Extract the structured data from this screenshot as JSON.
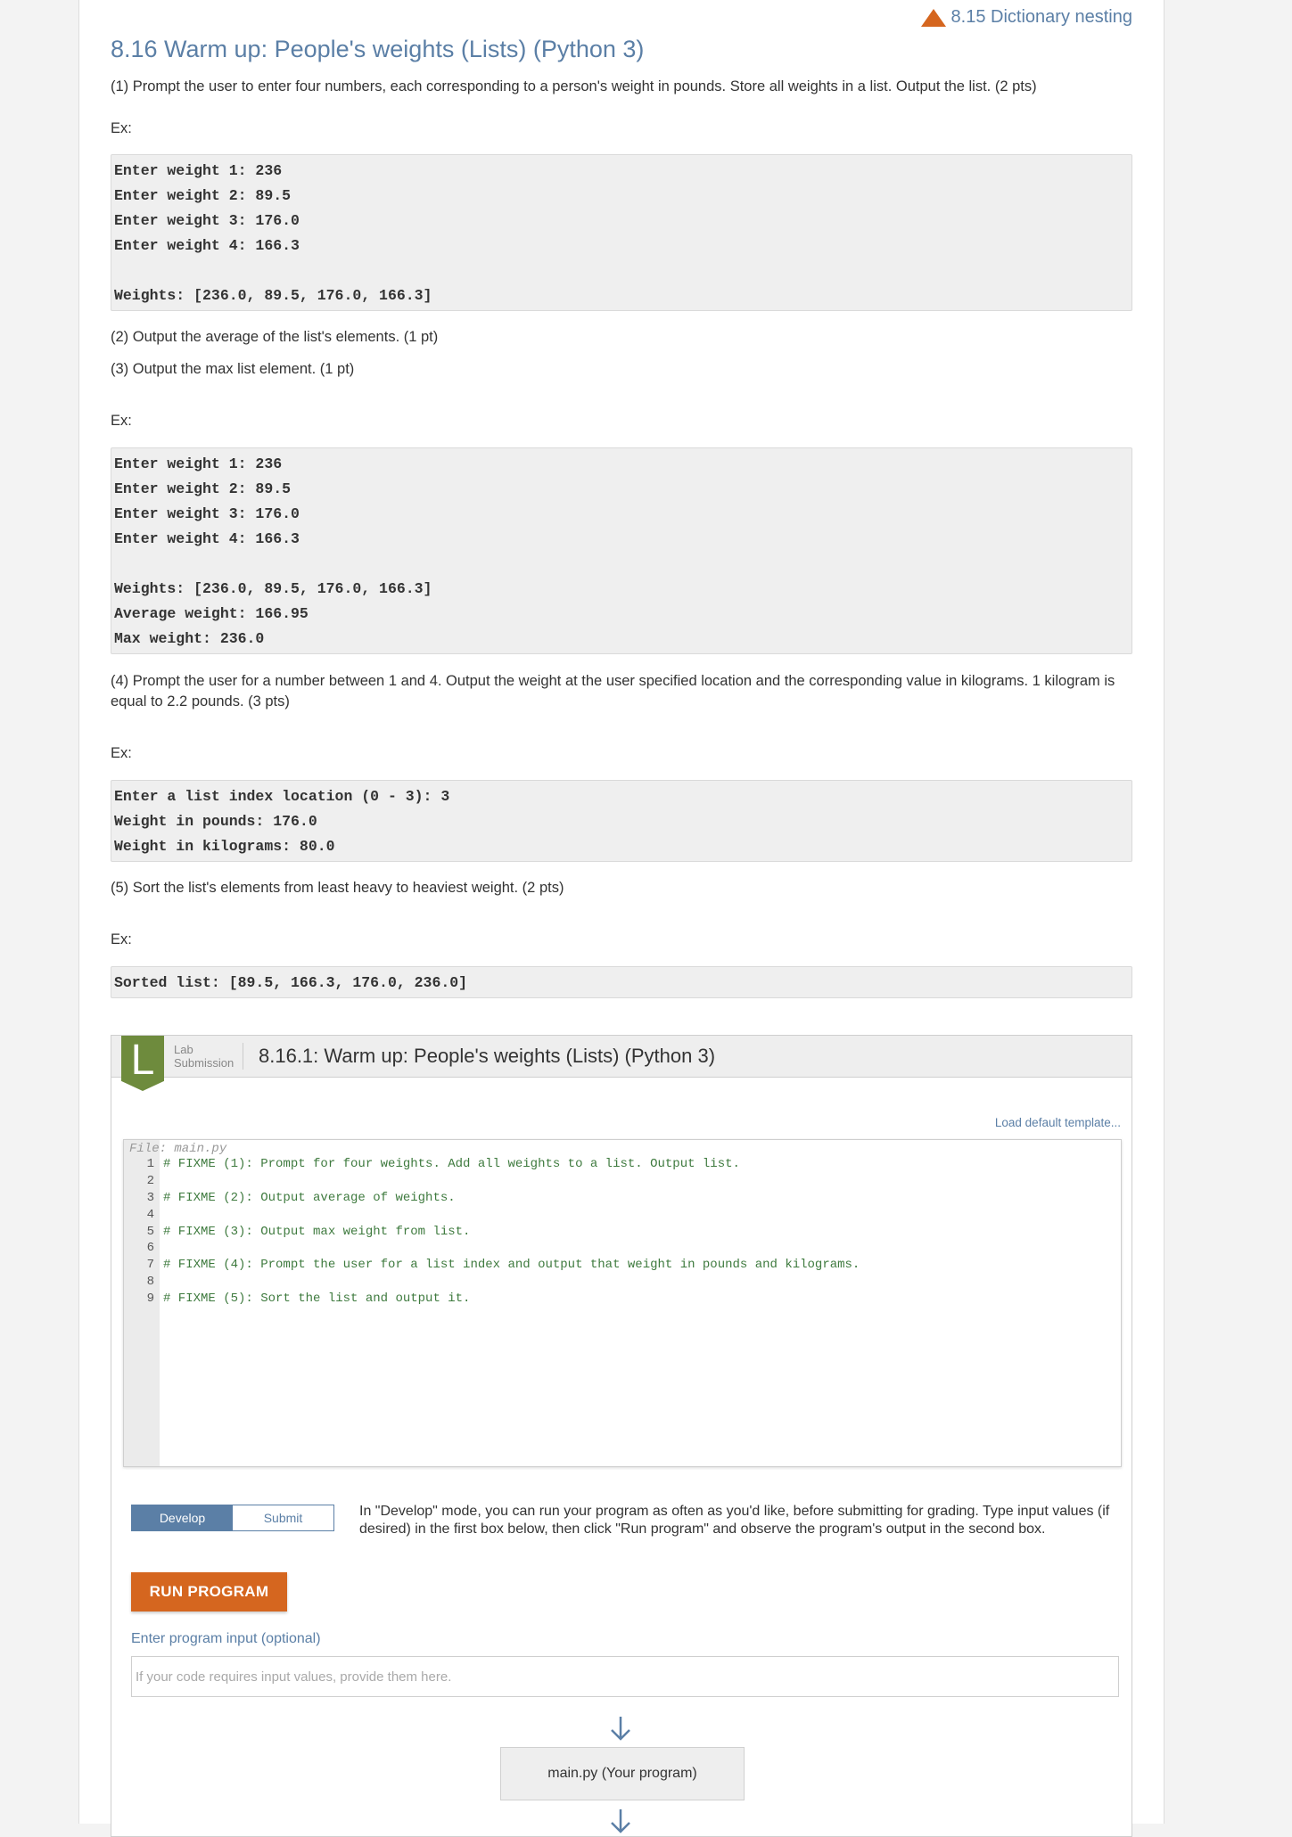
{
  "nav": {
    "prev_link": "8.15 Dictionary nesting"
  },
  "section": {
    "title": "8.16 Warm up: People's weights (Lists) (Python 3)",
    "p1": "(1) Prompt the user to enter four numbers, each corresponding to a person's weight in pounds. Store all weights in a list. Output the list. (2 pts)",
    "ex_label": "Ex:",
    "ex1_lines": [
      "Enter weight 1: 236",
      "Enter weight 2: 89.5",
      "Enter weight 3: 176.0",
      "Enter weight 4: 166.3",
      "",
      "Weights: [236.0, 89.5, 176.0, 166.3]"
    ],
    "p2": "(2) Output the average of the list's elements. (1 pt)",
    "p3": "(3) Output the max list element. (1 pt)",
    "ex2_lines": [
      "Enter weight 1: 236",
      "Enter weight 2: 89.5",
      "Enter weight 3: 176.0",
      "Enter weight 4: 166.3",
      "",
      "Weights: [236.0, 89.5, 176.0, 166.3]",
      "Average weight: 166.95",
      "Max weight: 236.0"
    ],
    "p4": "(4) Prompt the user for a number between 1 and 4. Output the weight at the user specified location and the corresponding value in kilograms. 1 kilogram is equal to 2.2 pounds. (3 pts)",
    "ex3_lines": [
      "Enter a list index location (0 - 3): 3",
      "Weight in pounds: 176.0",
      "Weight in kilograms: 80.0"
    ],
    "p5": "(5) Sort the list's elements from least heavy to heaviest weight. (2 pts)",
    "ex4_lines": [
      "Sorted list: [89.5, 166.3, 176.0, 236.0]"
    ]
  },
  "lab": {
    "badge_letter": "L",
    "kind_line1": "Lab",
    "kind_line2": "Submission",
    "title": "8.16.1: Warm up: People's weights (Lists) (Python 3)",
    "load_template": "Load default template...",
    "file_label": "File: main.py",
    "code": [
      {
        "n": "1",
        "t": "# FIXME (1): Prompt for four weights. Add all weights to a list. Output list."
      },
      {
        "n": "2",
        "t": ""
      },
      {
        "n": "3",
        "t": "# FIXME (2): Output average of weights."
      },
      {
        "n": "4",
        "t": ""
      },
      {
        "n": "5",
        "t": "# FIXME (3): Output max weight from list."
      },
      {
        "n": "6",
        "t": ""
      },
      {
        "n": "7",
        "t": "# FIXME (4): Prompt the user for a list index and output that weight in pounds and kilograms."
      },
      {
        "n": "8",
        "t": ""
      },
      {
        "n": "9",
        "t": "# FIXME (5): Sort the list and output it."
      }
    ],
    "mode_develop": "Develop",
    "mode_submit": "Submit",
    "mode_description": "In \"Develop\" mode, you can run your program as often as you'd like, before submitting for grading. Type input values (if desired) in the first box below, then click \"Run program\" and observe the program's output in the second box.",
    "run_button": "RUN PROGRAM",
    "input_label": "Enter program input (optional)",
    "input_placeholder": "If your code requires input values, provide them here.",
    "program_box": "main.py (Your program)"
  },
  "colors": {
    "link": "#5b7fa6",
    "accent": "#d5661f",
    "badge": "#6e8b3d"
  }
}
